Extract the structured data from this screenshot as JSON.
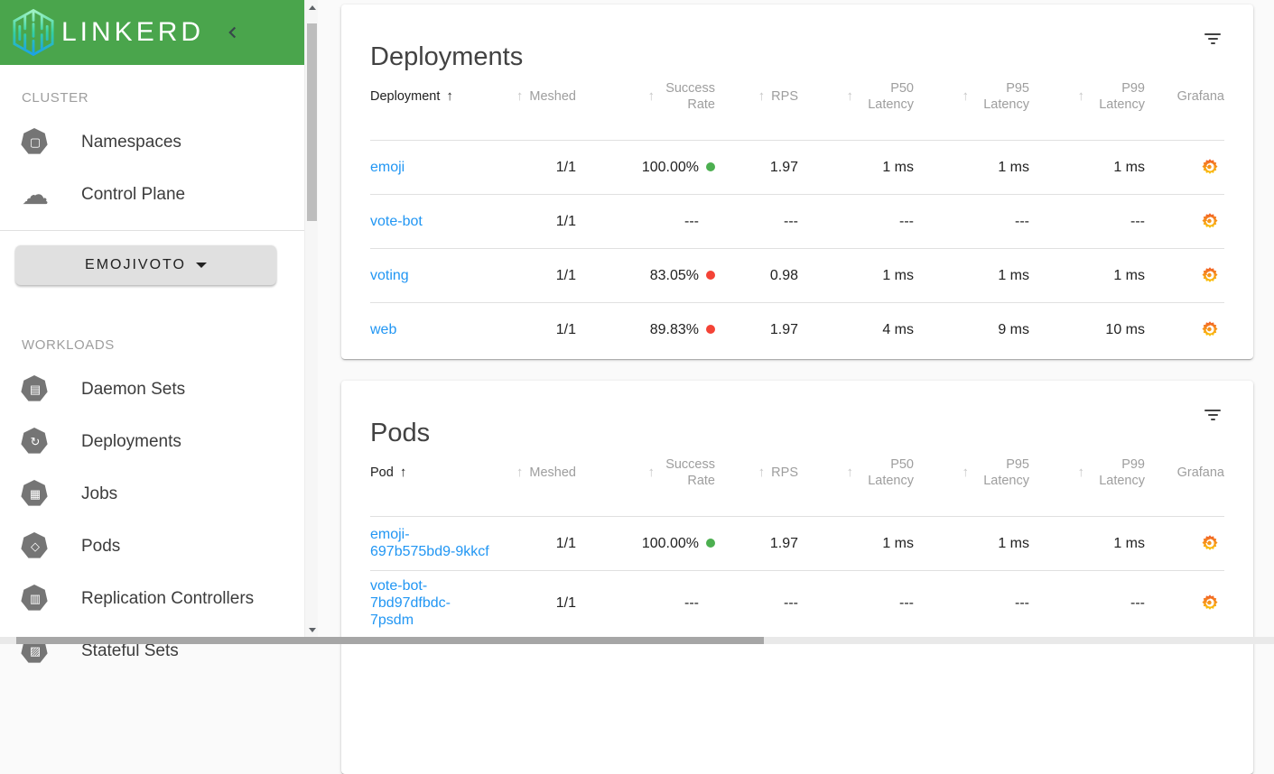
{
  "colors": {
    "header_green": "#4aa54c",
    "link_blue": "#2196f3",
    "status_good_green": "#4caf50",
    "status_bad_red": "#f44336",
    "grafana_orange": "#f15b2a",
    "grafana_yellow": "#fbca0a"
  },
  "app": {
    "logo_text": "LINKERD"
  },
  "sidebar": {
    "sections": [
      {
        "label": "CLUSTER",
        "items": [
          {
            "label": "Namespaces",
            "icon": "namespaces-icon"
          },
          {
            "label": "Control Plane",
            "icon": "control-plane-icon"
          }
        ]
      },
      {
        "label": "WORKLOADS",
        "items": [
          {
            "label": "Daemon Sets",
            "icon": "daemon-sets-icon"
          },
          {
            "label": "Deployments",
            "icon": "deployments-icon"
          },
          {
            "label": "Jobs",
            "icon": "jobs-icon"
          },
          {
            "label": "Pods",
            "icon": "pods-icon"
          },
          {
            "label": "Replication Controllers",
            "icon": "replication-controllers-icon"
          },
          {
            "label": "Stateful Sets",
            "icon": "stateful-sets-icon"
          }
        ]
      }
    ],
    "namespace_selector": {
      "label": "EMOJIVOTO"
    }
  },
  "cards": [
    {
      "id": "deployments",
      "title": "Deployments",
      "columns": [
        {
          "field": "name",
          "label": "Deployment",
          "sortable": true,
          "sorted": "asc",
          "align": "left",
          "type": "link"
        },
        {
          "field": "meshed",
          "label": "Meshed",
          "sortable": true,
          "align": "right"
        },
        {
          "field": "success_rate",
          "label": "Success Rate",
          "sortable": true,
          "align": "right",
          "type": "success"
        },
        {
          "field": "rps",
          "label": "RPS",
          "sortable": true,
          "align": "right"
        },
        {
          "field": "p50",
          "label": "P50 Latency",
          "sortable": true,
          "align": "right"
        },
        {
          "field": "p95",
          "label": "P95 Latency",
          "sortable": true,
          "align": "right"
        },
        {
          "field": "p99",
          "label": "P99 Latency",
          "sortable": true,
          "align": "right"
        },
        {
          "field": "grafana",
          "label": "Grafana",
          "sortable": false,
          "align": "right",
          "type": "grafana"
        }
      ],
      "rows": [
        {
          "name": "emoji",
          "meshed": "1/1",
          "success_rate": "100.00%",
          "status": "good",
          "rps": "1.97",
          "p50": "1 ms",
          "p95": "1 ms",
          "p99": "1 ms",
          "grafana": true
        },
        {
          "name": "vote-bot",
          "meshed": "1/1",
          "success_rate": "---",
          "status": null,
          "rps": "---",
          "p50": "---",
          "p95": "---",
          "p99": "---",
          "grafana": true
        },
        {
          "name": "voting",
          "meshed": "1/1",
          "success_rate": "83.05%",
          "status": "bad",
          "rps": "0.98",
          "p50": "1 ms",
          "p95": "1 ms",
          "p99": "1 ms",
          "grafana": true
        },
        {
          "name": "web",
          "meshed": "1/1",
          "success_rate": "89.83%",
          "status": "bad",
          "rps": "1.97",
          "p50": "4 ms",
          "p95": "9 ms",
          "p99": "10 ms",
          "grafana": true
        }
      ]
    },
    {
      "id": "pods",
      "title": "Pods",
      "columns": [
        {
          "field": "name",
          "label": "Pod",
          "sortable": true,
          "sorted": "asc",
          "align": "left",
          "type": "link"
        },
        {
          "field": "meshed",
          "label": "Meshed",
          "sortable": true,
          "align": "right"
        },
        {
          "field": "success_rate",
          "label": "Success Rate",
          "sortable": true,
          "align": "right",
          "type": "success"
        },
        {
          "field": "rps",
          "label": "RPS",
          "sortable": true,
          "align": "right"
        },
        {
          "field": "p50",
          "label": "P50 Latency",
          "sortable": true,
          "align": "right"
        },
        {
          "field": "p95",
          "label": "P95 Latency",
          "sortable": true,
          "align": "right"
        },
        {
          "field": "p99",
          "label": "P99 Latency",
          "sortable": true,
          "align": "right"
        },
        {
          "field": "grafana",
          "label": "Grafana",
          "sortable": false,
          "align": "right",
          "type": "grafana"
        }
      ],
      "rows": [
        {
          "name": "emoji-697b575bd9-9kkcf",
          "meshed": "1/1",
          "success_rate": "100.00%",
          "status": "good",
          "rps": "1.97",
          "p50": "1 ms",
          "p95": "1 ms",
          "p99": "1 ms",
          "grafana": true
        },
        {
          "name": "vote-bot-7bd97dfbdc-7psdm",
          "meshed": "1/1",
          "success_rate": "---",
          "status": null,
          "rps": "---",
          "p50": "---",
          "p95": "---",
          "p99": "---",
          "grafana": true
        }
      ]
    }
  ]
}
